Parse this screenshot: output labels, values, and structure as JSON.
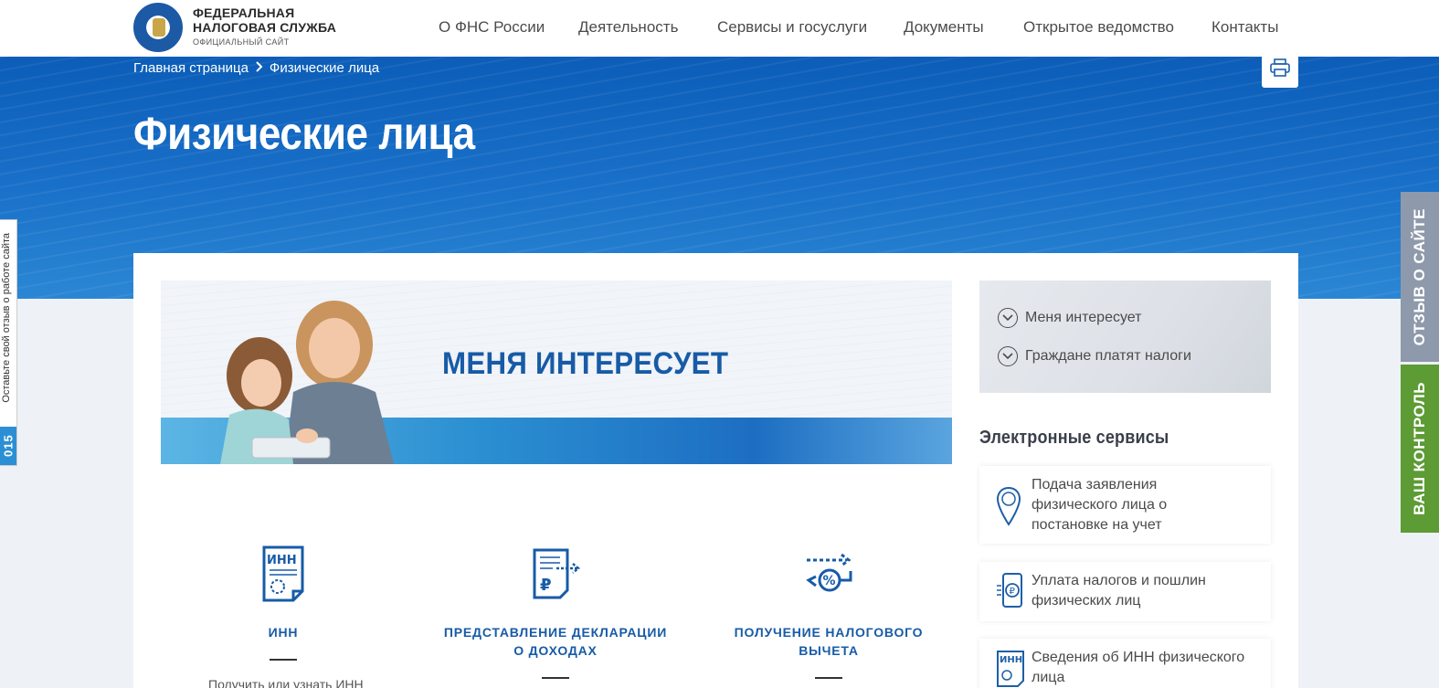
{
  "header": {
    "logo_line1": "ФЕДЕРАЛЬНАЯ",
    "logo_line2": "НАЛОГОВАЯ СЛУЖБА",
    "logo_sub": "ОФИЦИАЛЬНЫЙ САЙТ",
    "nav": [
      "О ФНС России",
      "Деятельность",
      "Сервисы и госуслуги",
      "Документы",
      "Открытое ведомство",
      "Контакты"
    ]
  },
  "breadcrumb": {
    "home": "Главная страница",
    "separator": ">",
    "current": "Физические лица"
  },
  "page_title": "Физические лица",
  "hero": {
    "title": "МЕНЯ ИНТЕРЕСУЕТ"
  },
  "interest": {
    "items": [
      "Меня интересует",
      "Граждане платят налоги"
    ]
  },
  "services": {
    "heading": "Электронные сервисы",
    "items": [
      {
        "label_lines": [
          "Подача заявления",
          "физического лица о",
          "постановке на учет"
        ],
        "icon": "location-pin-icon"
      },
      {
        "label_lines": [
          "Уплата налогов и пошлин",
          "физических лиц"
        ],
        "icon": "phone-payment-icon"
      },
      {
        "label_lines": [
          "Сведения об ИНН физического",
          "лица"
        ],
        "icon": "inn-document-icon"
      }
    ]
  },
  "categories": [
    {
      "title_lines": [
        "ИНН"
      ],
      "icon": "inn-document-icon",
      "text": "Получить или узнать ИНН"
    },
    {
      "title_lines": [
        "ПРЕДСТАВЛЕНИЕ ДЕКЛАРАЦИИ",
        "О ДОХОДАХ"
      ],
      "icon": "declaration-icon"
    },
    {
      "title_lines": [
        "ПОЛУЧЕНИЕ НАЛОГОВОГО",
        "ВЫЧЕТА"
      ],
      "icon": "tax-deduction-icon"
    }
  ],
  "side_tabs": {
    "feedback": "ОТЗЫВ О САЙТЕ",
    "control": "ВАШ КОНТРОЛЬ"
  },
  "left_tab": {
    "text": "Оставьте свой отзыв о работе сайта",
    "number": "015"
  },
  "colors": {
    "brand_blue": "#175ba7",
    "banner_blue": "#0b5db8",
    "feedback_tab": "#8e9aab",
    "control_tab": "#5d9b35"
  }
}
